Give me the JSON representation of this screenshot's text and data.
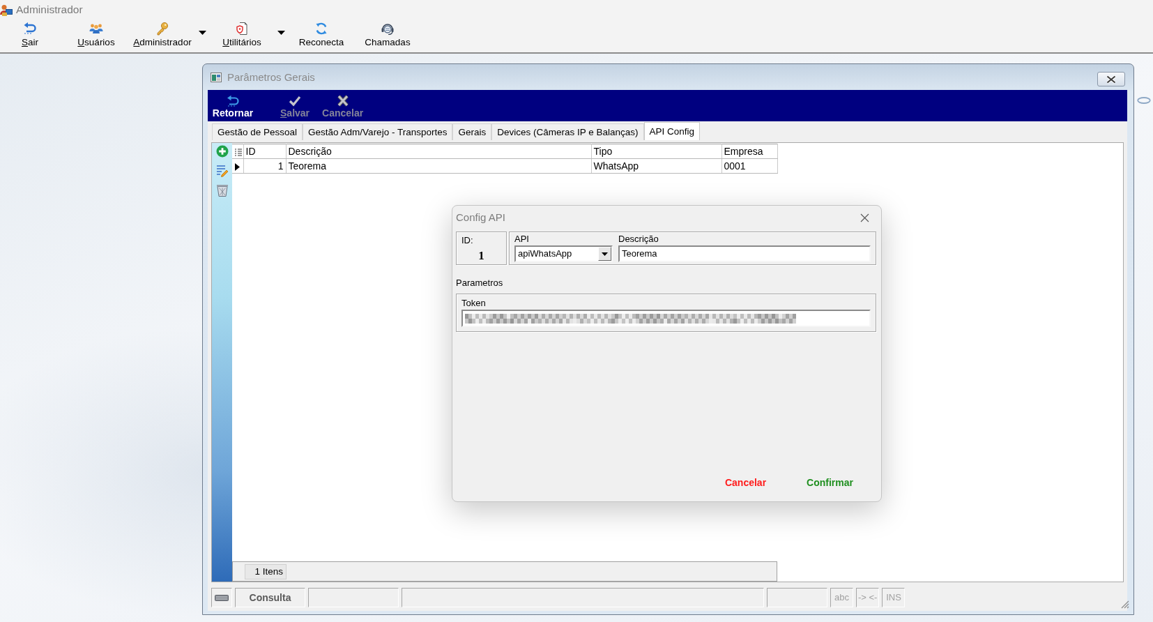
{
  "app": {
    "title": "Administrador"
  },
  "app_toolbar": [
    {
      "label": "Sair",
      "mnemonic": true,
      "dropdown": false
    },
    {
      "label": "Usuários",
      "mnemonic": true,
      "dropdown": false
    },
    {
      "label": "Administrador",
      "mnemonic": true,
      "dropdown": true
    },
    {
      "label": "Utilitários",
      "mnemonic": true,
      "dropdown": true
    },
    {
      "label": "Reconecta",
      "mnemonic": false,
      "dropdown": false
    },
    {
      "label": "Chamadas",
      "mnemonic": false,
      "dropdown": false
    }
  ],
  "window": {
    "title": "Parâmetros Gerais"
  },
  "form_toolbar": [
    {
      "label": "Retornar",
      "disabled": false,
      "mnemonic": false
    },
    {
      "label": "Salvar",
      "disabled": true,
      "mnemonic": true
    },
    {
      "label": "Cancelar",
      "disabled": true,
      "mnemonic": false
    }
  ],
  "tabs": [
    {
      "label": "Gestão de Pessoal",
      "selected": false
    },
    {
      "label": "Gestão Adm/Varejo - Transportes",
      "selected": false
    },
    {
      "label": "Gerais",
      "selected": false
    },
    {
      "label": "Devices (Câmeras IP e Balanças)",
      "selected": false
    },
    {
      "label": "API Config",
      "selected": true
    }
  ],
  "grid": {
    "columns": [
      "ID",
      "Descrição",
      "Tipo",
      "Empresa"
    ],
    "rows": [
      {
        "cells": [
          "1",
          "Teorema",
          "WhatsApp",
          "0001"
        ],
        "selected": true
      }
    ],
    "footer": "1 Itens"
  },
  "status_bar": {
    "mode": "Consulta",
    "indicators": [
      {
        "label": "abc",
        "on": false
      },
      {
        "label": "-> <-",
        "on": false
      },
      {
        "label": "INS",
        "on": false
      }
    ]
  },
  "dialog": {
    "title": "Config API",
    "id_label": "ID:",
    "id_value": "1",
    "api_label": "API",
    "api_value": "apiWhatsApp",
    "description_label": "Descrição",
    "description_value": "Teorema",
    "section_label": "Parametros",
    "params": [
      {
        "label": "Token",
        "redacted": true
      }
    ],
    "buttons": [
      {
        "label": "Cancelar",
        "kind": "cancel"
      },
      {
        "label": "Confirmar",
        "kind": "confirm"
      }
    ]
  }
}
